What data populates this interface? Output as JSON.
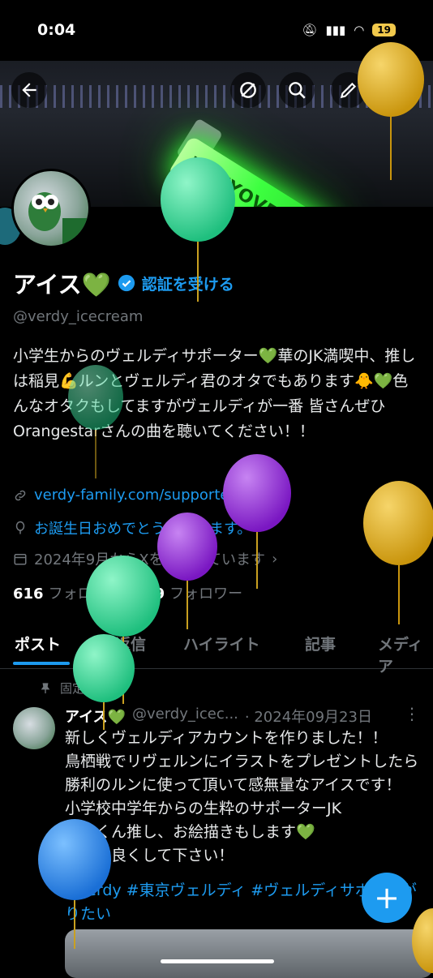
{
  "status_bar": {
    "time": "0:04",
    "battery": "19"
  },
  "banner": {
    "stick_text": "TOKYOVERDY"
  },
  "profile": {
    "display_name": "アイス💚",
    "verify_label": "認証を受ける",
    "handle": "@verdy_icecream",
    "bio": "小学生からのヴェルディサポーター💚華のJK満喫中、推しは稲見💪ルンとヴェルディ君のオタでもあります🐥💚色んなオタクもしてますがヴェルディが一番 皆さんぜひOrangestarさんの曲を聴いてください！！",
    "website": "verdy-family.com/supporters/sup...",
    "birthday": "お誕生日おめでとうございます。",
    "joined": "2024年9月からXを利用しています",
    "following_count": "616",
    "following_label": "フォロー",
    "followers_count": "449",
    "followers_label": "フォロワー"
  },
  "tabs": [
    {
      "label": "ポスト"
    },
    {
      "label": "返信"
    },
    {
      "label": "ハイライト"
    },
    {
      "label": "記事"
    },
    {
      "label": "メディア"
    }
  ],
  "post": {
    "pinned_label": "固定",
    "author": "アイス💚",
    "handle": "@verdy_icec...",
    "date": "· 2024年09月23日",
    "text": "新しくヴェルディアカウントを作りました！！\n鳥栖戦でリヴェルンにイラストをプレゼントしたら勝利のルンに使って頂いて感無量なアイスです！\n小学校中学年からの生粋のサポーターJK\n稲見くん推し、お絵描きもします💚\nぜひ仲良くして下さい！",
    "tags": "#verdy #東京ヴェルディ #ヴェルディサポと繋がりたい"
  },
  "fab_label": "+",
  "icons": {
    "back": "back-arrow-icon",
    "no_translate": "slash-circle-icon",
    "search": "search-icon",
    "edit": "pencil-icon",
    "verified": "verified-badge-icon",
    "link": "link-icon",
    "birthday": "balloon-icon",
    "calendar": "calendar-icon",
    "pin": "pin-icon"
  },
  "colors": {
    "accent": "#1d9bf0",
    "background": "#000000",
    "muted": "#71767b",
    "balloon_green": "#3ed89a",
    "balloon_purple": "#9b2fd6",
    "balloon_gold": "#e3b41f",
    "balloon_blue": "#2f8ff0"
  }
}
